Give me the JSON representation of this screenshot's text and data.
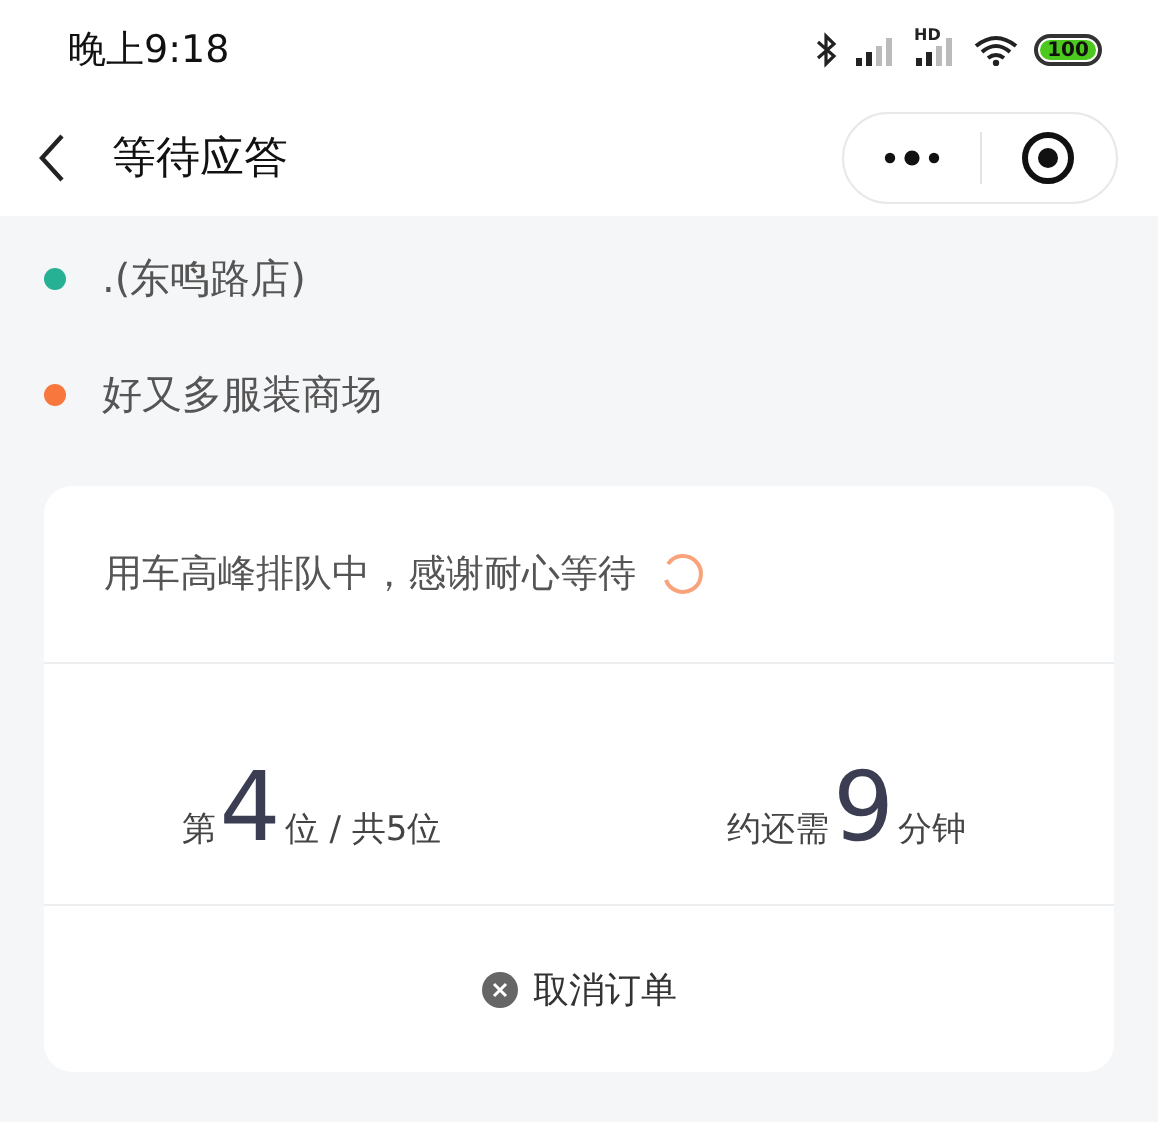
{
  "status_bar": {
    "time": "晚上9:18",
    "battery": "100",
    "network_label": "HD"
  },
  "nav_bar": {
    "title": "等待应答"
  },
  "route": [
    {
      "label": ".(东鸣路店)",
      "color": "#26b195"
    },
    {
      "label": "好又多服装商场",
      "color": "#f7773d"
    }
  ],
  "card": {
    "message": "用车高峰排队中，感谢耐心等待",
    "stats": [
      {
        "prefix": "第",
        "number": "4",
        "suffix": "位 / 共5位"
      },
      {
        "prefix": "约还需",
        "number": "9",
        "suffix": "分钟"
      }
    ],
    "cancel_button": "取消订单"
  }
}
